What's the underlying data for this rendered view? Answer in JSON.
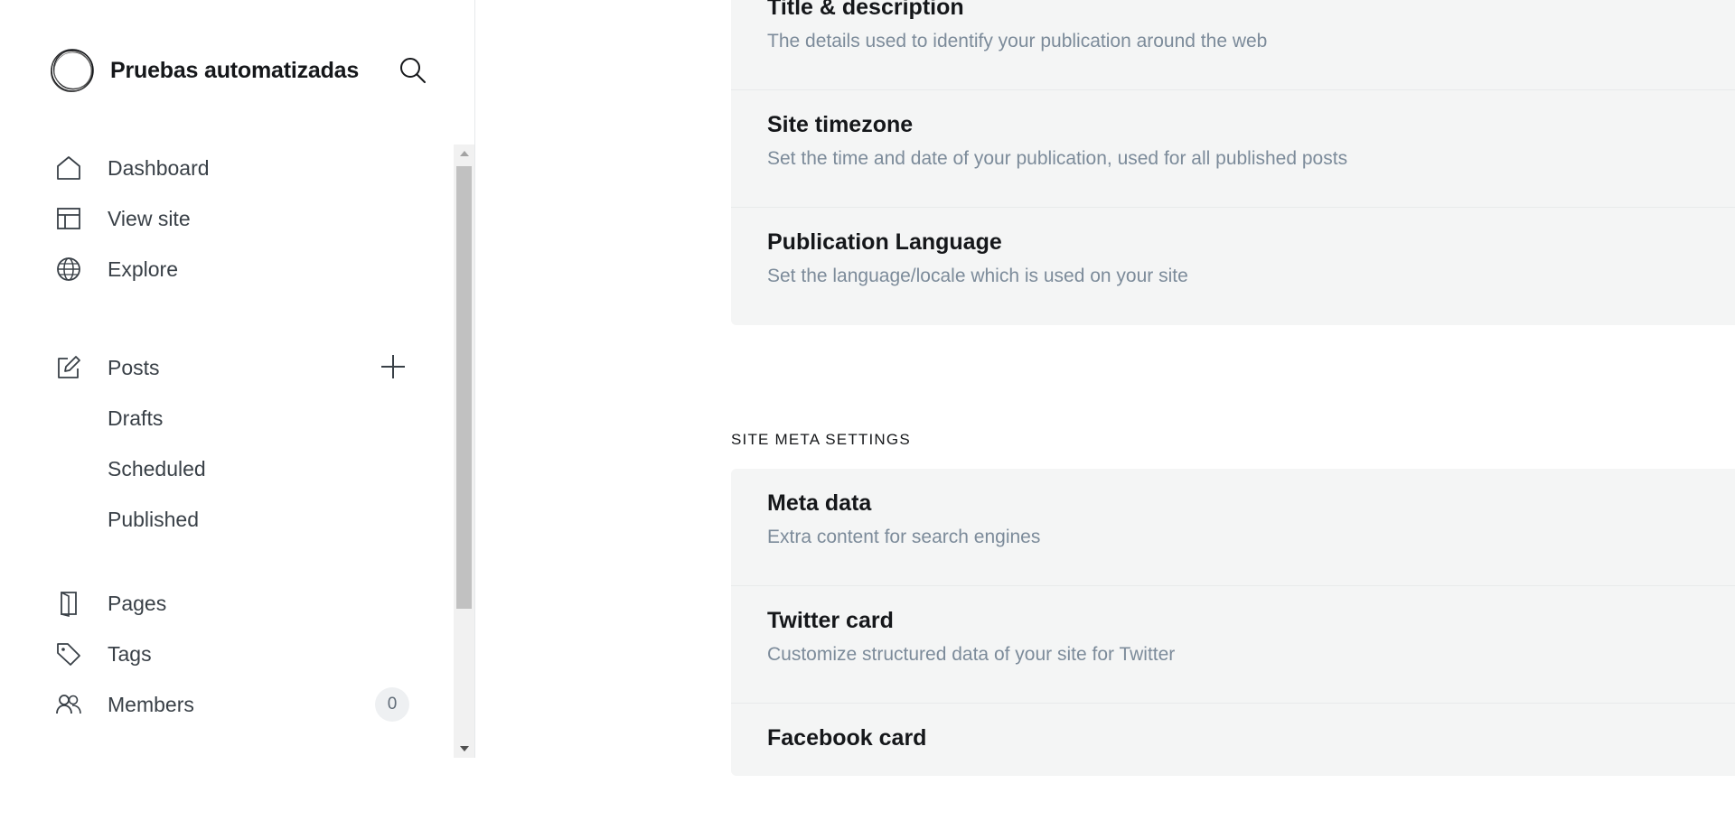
{
  "brand": {
    "name": "Pruebas automatizadas",
    "logo_icon": "scribble-circle-logo"
  },
  "header": {
    "search_icon": "search-icon"
  },
  "sidebar": {
    "nav_primary": [
      {
        "label": "Dashboard",
        "icon": "home-icon"
      },
      {
        "label": "View site",
        "icon": "layout-icon"
      },
      {
        "label": "Explore",
        "icon": "globe-icon"
      }
    ],
    "posts": {
      "label": "Posts",
      "icon": "edit-icon",
      "add_icon": "plus-icon",
      "sub_items": [
        "Drafts",
        "Scheduled",
        "Published"
      ]
    },
    "nav_secondary": [
      {
        "label": "Pages",
        "icon": "page-icon"
      },
      {
        "label": "Tags",
        "icon": "tag-icon"
      },
      {
        "label": "Members",
        "icon": "members-icon",
        "count": "0"
      }
    ]
  },
  "main": {
    "general_group": [
      {
        "title": "Title & description",
        "description": "The details used to identify your publication around the web"
      },
      {
        "title": "Site timezone",
        "description": "Set the time and date of your publication, used for all published posts"
      },
      {
        "title": "Publication Language",
        "description": "Set the language/locale which is used on your site"
      }
    ],
    "meta_section_title": "SITE META SETTINGS",
    "meta_group": [
      {
        "title": "Meta data",
        "description": "Extra content for search engines"
      },
      {
        "title": "Twitter card",
        "description": "Customize structured data of your site for Twitter"
      },
      {
        "title": "Facebook card",
        "description": ""
      }
    ]
  },
  "colors": {
    "panel_bg": "#f4f5f5",
    "text_primary": "#15171a",
    "text_muted": "#7c8b9a",
    "nav_text": "#394047"
  }
}
